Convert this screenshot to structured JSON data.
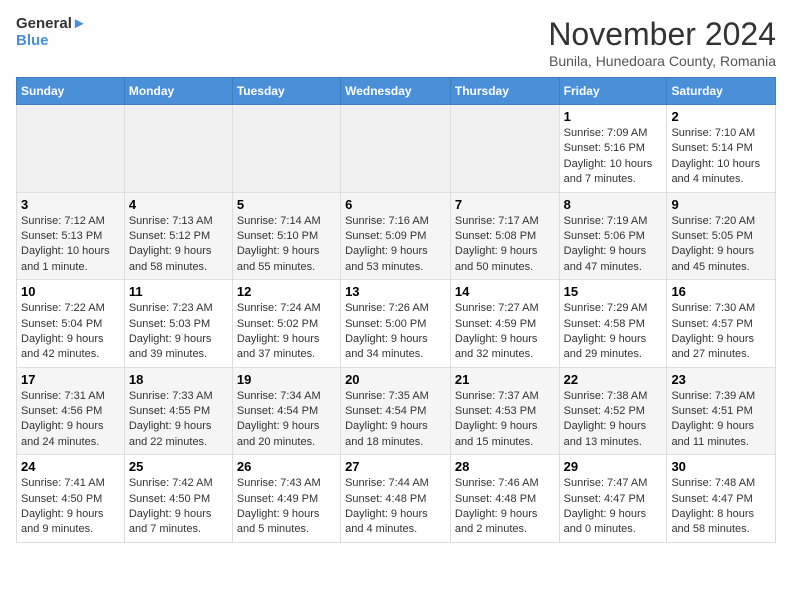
{
  "logo": {
    "line1": "General",
    "line2": "Blue"
  },
  "title": "November 2024",
  "subtitle": "Bunila, Hunedoara County, Romania",
  "headers": [
    "Sunday",
    "Monday",
    "Tuesday",
    "Wednesday",
    "Thursday",
    "Friday",
    "Saturday"
  ],
  "weeks": [
    [
      {
        "day": "",
        "info": ""
      },
      {
        "day": "",
        "info": ""
      },
      {
        "day": "",
        "info": ""
      },
      {
        "day": "",
        "info": ""
      },
      {
        "day": "",
        "info": ""
      },
      {
        "day": "1",
        "info": "Sunrise: 7:09 AM\nSunset: 5:16 PM\nDaylight: 10 hours and 7 minutes."
      },
      {
        "day": "2",
        "info": "Sunrise: 7:10 AM\nSunset: 5:14 PM\nDaylight: 10 hours and 4 minutes."
      }
    ],
    [
      {
        "day": "3",
        "info": "Sunrise: 7:12 AM\nSunset: 5:13 PM\nDaylight: 10 hours and 1 minute."
      },
      {
        "day": "4",
        "info": "Sunrise: 7:13 AM\nSunset: 5:12 PM\nDaylight: 9 hours and 58 minutes."
      },
      {
        "day": "5",
        "info": "Sunrise: 7:14 AM\nSunset: 5:10 PM\nDaylight: 9 hours and 55 minutes."
      },
      {
        "day": "6",
        "info": "Sunrise: 7:16 AM\nSunset: 5:09 PM\nDaylight: 9 hours and 53 minutes."
      },
      {
        "day": "7",
        "info": "Sunrise: 7:17 AM\nSunset: 5:08 PM\nDaylight: 9 hours and 50 minutes."
      },
      {
        "day": "8",
        "info": "Sunrise: 7:19 AM\nSunset: 5:06 PM\nDaylight: 9 hours and 47 minutes."
      },
      {
        "day": "9",
        "info": "Sunrise: 7:20 AM\nSunset: 5:05 PM\nDaylight: 9 hours and 45 minutes."
      }
    ],
    [
      {
        "day": "10",
        "info": "Sunrise: 7:22 AM\nSunset: 5:04 PM\nDaylight: 9 hours and 42 minutes."
      },
      {
        "day": "11",
        "info": "Sunrise: 7:23 AM\nSunset: 5:03 PM\nDaylight: 9 hours and 39 minutes."
      },
      {
        "day": "12",
        "info": "Sunrise: 7:24 AM\nSunset: 5:02 PM\nDaylight: 9 hours and 37 minutes."
      },
      {
        "day": "13",
        "info": "Sunrise: 7:26 AM\nSunset: 5:00 PM\nDaylight: 9 hours and 34 minutes."
      },
      {
        "day": "14",
        "info": "Sunrise: 7:27 AM\nSunset: 4:59 PM\nDaylight: 9 hours and 32 minutes."
      },
      {
        "day": "15",
        "info": "Sunrise: 7:29 AM\nSunset: 4:58 PM\nDaylight: 9 hours and 29 minutes."
      },
      {
        "day": "16",
        "info": "Sunrise: 7:30 AM\nSunset: 4:57 PM\nDaylight: 9 hours and 27 minutes."
      }
    ],
    [
      {
        "day": "17",
        "info": "Sunrise: 7:31 AM\nSunset: 4:56 PM\nDaylight: 9 hours and 24 minutes."
      },
      {
        "day": "18",
        "info": "Sunrise: 7:33 AM\nSunset: 4:55 PM\nDaylight: 9 hours and 22 minutes."
      },
      {
        "day": "19",
        "info": "Sunrise: 7:34 AM\nSunset: 4:54 PM\nDaylight: 9 hours and 20 minutes."
      },
      {
        "day": "20",
        "info": "Sunrise: 7:35 AM\nSunset: 4:54 PM\nDaylight: 9 hours and 18 minutes."
      },
      {
        "day": "21",
        "info": "Sunrise: 7:37 AM\nSunset: 4:53 PM\nDaylight: 9 hours and 15 minutes."
      },
      {
        "day": "22",
        "info": "Sunrise: 7:38 AM\nSunset: 4:52 PM\nDaylight: 9 hours and 13 minutes."
      },
      {
        "day": "23",
        "info": "Sunrise: 7:39 AM\nSunset: 4:51 PM\nDaylight: 9 hours and 11 minutes."
      }
    ],
    [
      {
        "day": "24",
        "info": "Sunrise: 7:41 AM\nSunset: 4:50 PM\nDaylight: 9 hours and 9 minutes."
      },
      {
        "day": "25",
        "info": "Sunrise: 7:42 AM\nSunset: 4:50 PM\nDaylight: 9 hours and 7 minutes."
      },
      {
        "day": "26",
        "info": "Sunrise: 7:43 AM\nSunset: 4:49 PM\nDaylight: 9 hours and 5 minutes."
      },
      {
        "day": "27",
        "info": "Sunrise: 7:44 AM\nSunset: 4:48 PM\nDaylight: 9 hours and 4 minutes."
      },
      {
        "day": "28",
        "info": "Sunrise: 7:46 AM\nSunset: 4:48 PM\nDaylight: 9 hours and 2 minutes."
      },
      {
        "day": "29",
        "info": "Sunrise: 7:47 AM\nSunset: 4:47 PM\nDaylight: 9 hours and 0 minutes."
      },
      {
        "day": "30",
        "info": "Sunrise: 7:48 AM\nSunset: 4:47 PM\nDaylight: 8 hours and 58 minutes."
      }
    ]
  ]
}
